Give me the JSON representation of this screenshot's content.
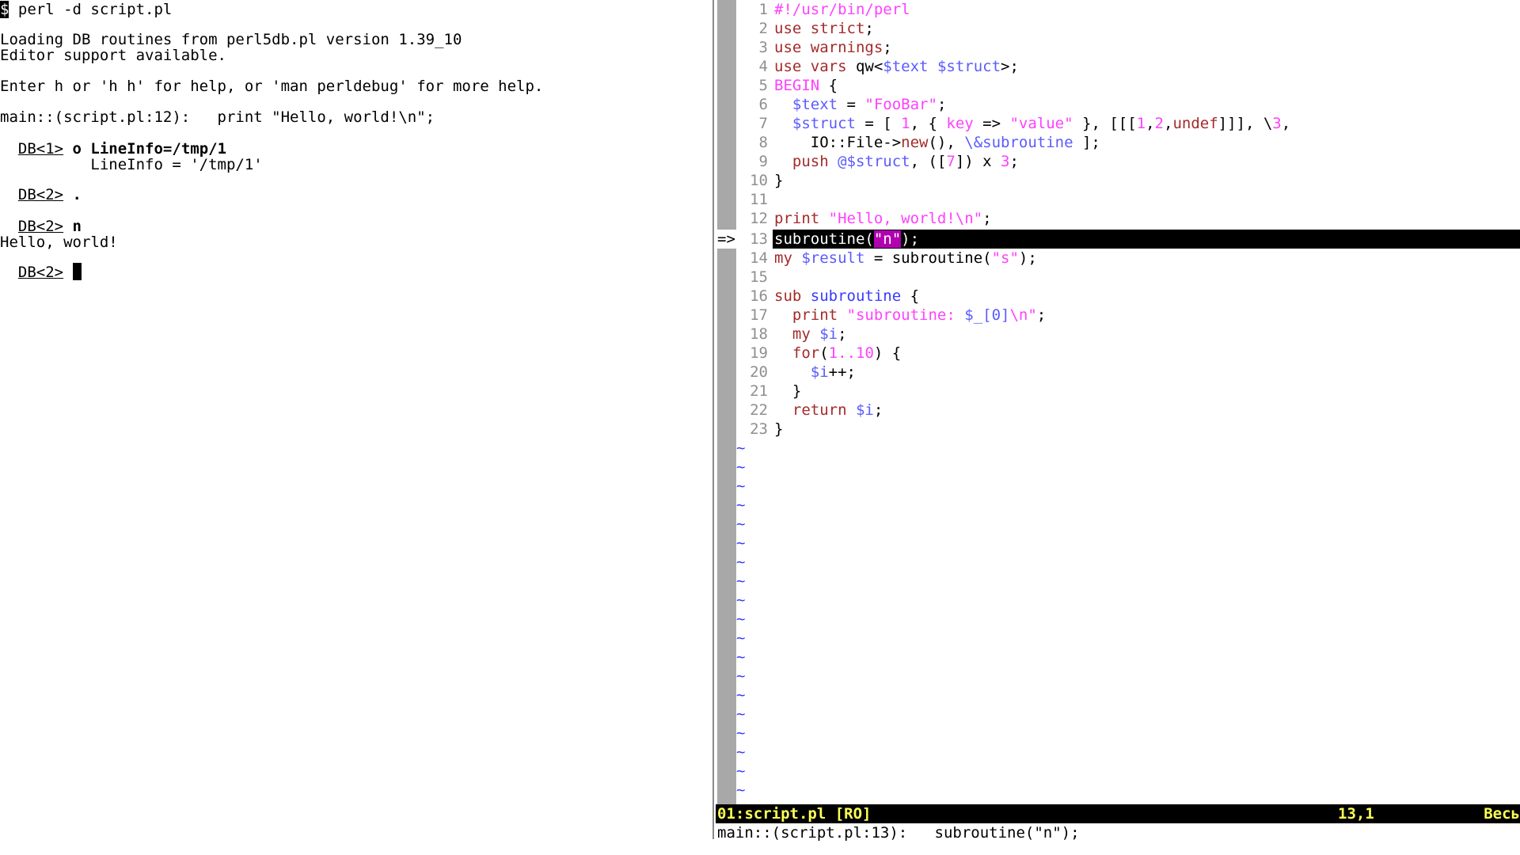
{
  "terminal": {
    "command_prompt": "$",
    "command": " perl -d script.pl",
    "loading_line": "Loading DB routines from perl5db.pl version 1.39_10",
    "editor_support": "Editor support available.",
    "help_line": "Enter h or 'h h' for help, or 'man perldebug' for more help.",
    "main_line": "main::(script.pl:12):   print \"Hello, world!\\n\";",
    "db1_prompt": "DB<1>",
    "db1_command": "o LineInfo=/tmp/1",
    "lineinfo_output": "          LineInfo = '/tmp/1'",
    "db2_prompt_a": "DB<2>",
    "db2_command_a": ".",
    "db2_prompt_b": "DB<2>",
    "db2_command_b": "n",
    "hello_output": "Hello, world!",
    "db2_prompt_c": "DB<2>"
  },
  "vim": {
    "current_marker": "=>",
    "line_numbers": [
      "1",
      "2",
      "3",
      "4",
      "5",
      "6",
      "7",
      "8",
      "9",
      "10",
      "11",
      "12",
      "13",
      "14",
      "15",
      "16",
      "17",
      "18",
      "19",
      "20",
      "21",
      "22",
      "23"
    ],
    "status_filename": "01:script.pl [RO]",
    "status_position": "13,1",
    "status_scroll": "Весь",
    "command_line": "main::(script.pl:13):   subroutine(\"n\");",
    "tilde": "~",
    "code": {
      "l1": "#!/usr/bin/perl",
      "l2_kw": "use strict",
      "l2_end": ";",
      "l3_kw": "use warnings",
      "l3_end": ";",
      "l4_kw": "use vars",
      "l4_a": " qw<",
      "l4_v1": "$text",
      "l4_sp": " ",
      "l4_v2": "$struct",
      "l4_end": ">;",
      "l5_kw": "BEGIN",
      "l5_end": " {",
      "l6_pad": "  ",
      "l6_var": "$text",
      "l6_eq": " = ",
      "l6_str": "\"FooBar\"",
      "l6_end": ";",
      "l7_pad": "  ",
      "l7_var": "$struct",
      "l7_a": " = [ ",
      "l7_n1": "1",
      "l7_b": ", { ",
      "l7_key": "key",
      "l7_c": " => ",
      "l7_str": "\"value\"",
      "l7_d": " }, [[[",
      "l7_n2": "1",
      "l7_e": ",",
      "l7_n3": "2",
      "l7_f": ",",
      "l7_undef": "undef",
      "l7_g": "]]], \\",
      "l7_n4": "3",
      "l7_end": ",",
      "l8_a": "    IO::File->",
      "l8_new": "new",
      "l8_b": "(), ",
      "l8_ref": "\\&subroutine",
      "l8_end": " ];",
      "l9_pad": "  ",
      "l9_kw": "push",
      "l9_sp": " ",
      "l9_var": "@$struct",
      "l9_a": ", ([",
      "l9_n1": "7",
      "l9_b": "]) x ",
      "l9_n2": "3",
      "l9_end": ";",
      "l10": "}",
      "l12_kw": "print",
      "l12_sp": " ",
      "l12_str": "\"Hello, world!\\n\"",
      "l12_end": ";",
      "l13_a": "subroutine(",
      "l13_str": "\"n\"",
      "l13_end": ");",
      "l14_kw": "my",
      "l14_sp": " ",
      "l14_var": "$result",
      "l14_a": " = subroutine(",
      "l14_str": "\"s\"",
      "l14_end": ");",
      "l16_kw": "sub",
      "l16_sp": " ",
      "l16_name": "subroutine",
      "l16_end": " {",
      "l17_pad": "  ",
      "l17_kw": "print",
      "l17_sp": " ",
      "l17_str": "\"subroutine: ",
      "l17_var": "$_[0]",
      "l17_str2": "\\n\"",
      "l17_end": ";",
      "l18_pad": "  ",
      "l18_kw": "my",
      "l18_sp": " ",
      "l18_var": "$i",
      "l18_end": ";",
      "l19_pad": "  ",
      "l19_kw": "for",
      "l19_a": "(",
      "l19_n1": "1",
      "l19_b": "..",
      "l19_n2": "10",
      "l19_end": ") {",
      "l20_pad": "    ",
      "l20_var": "$i",
      "l20_end": "++;",
      "l21": "  }",
      "l22_pad": "  ",
      "l22_kw": "return",
      "l22_sp": " ",
      "l22_var": "$i",
      "l22_end": ";",
      "l23": "}"
    }
  },
  "colors": {
    "keyword": "#a52a2a",
    "variable": "#5b5bff",
    "string": "#ff40ff",
    "status_text": "#ffff54",
    "signcolumn": "#a8a8a8"
  }
}
